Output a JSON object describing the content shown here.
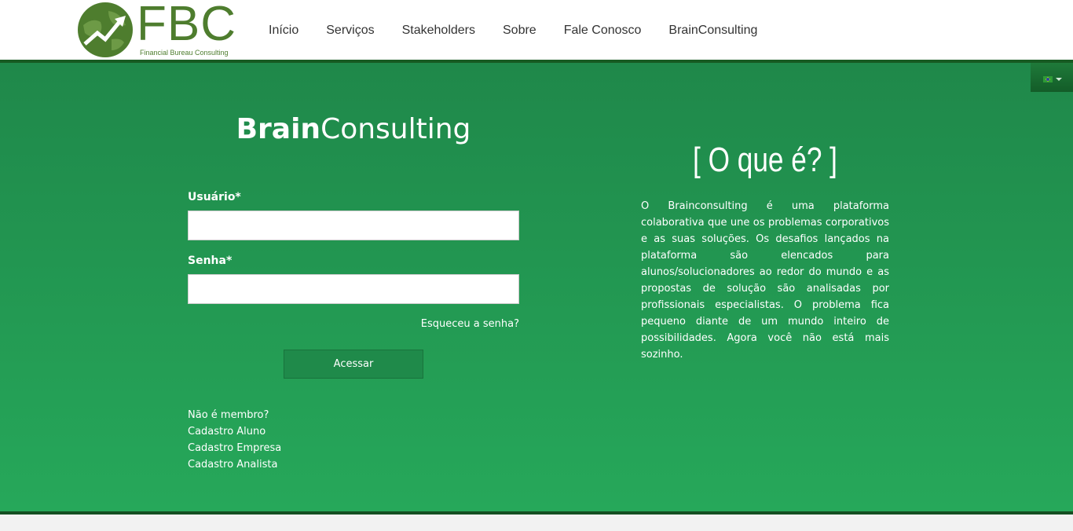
{
  "header": {
    "logo_letters": "FBC",
    "logo_subtitle": "Financial Bureau Consulting",
    "nav": [
      "Início",
      "Serviços",
      "Stakeholders",
      "Sobre",
      "Fale Conosco",
      "BrainConsulting"
    ]
  },
  "language": {
    "selected": "pt-BR",
    "icon": "brazil-flag-icon"
  },
  "login": {
    "title_bold": "Brain",
    "title_light": "Consulting",
    "username_label": "Usuário*",
    "username_value": "",
    "password_label": "Senha*",
    "password_value": "",
    "forgot_link": "Esqueceu a senha?",
    "submit_label": "Acessar",
    "not_member": "Não é membro?",
    "register_student": "Cadastro Aluno",
    "register_company": "Cadastro Empresa",
    "register_analyst": "Cadastro Analista"
  },
  "about": {
    "title": "[ O que é? ]",
    "text": "O Brainconsulting é uma plataforma colaborativa que une os problemas corporativos e as suas soluções. Os desafios lançados na plataforma são elencados para alunos/solucionadores ao redor do mundo e as propostas de solução são analisadas por profissionais especialistas. O problema fica pequeno diante de um mundo inteiro de possibilidades. Agora você não está mais sozinho."
  },
  "colors": {
    "brand_green": "#26a85a",
    "dark_green": "#175a22",
    "logo_green": "#4e7d2e"
  }
}
